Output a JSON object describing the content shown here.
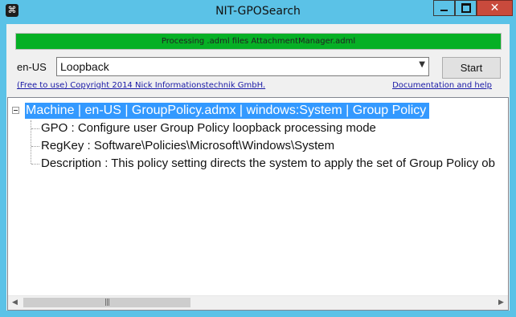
{
  "window": {
    "title": "NIT-GPOSearch",
    "icon": "gpo-search-app-icon",
    "controls": {
      "minimize": "minimize-icon",
      "maximize": "maximize-icon",
      "close": "✕"
    }
  },
  "progress": {
    "text": "Processing .adml files AttachmentManager.adml",
    "value": 1.0,
    "color": "#06b025"
  },
  "search": {
    "language": "en-US",
    "query": "Loopback",
    "start_label": "Start"
  },
  "links": {
    "copyright": "(Free to use) Copyright 2014 Nick Informationstechnik GmbH.",
    "documentation": "Documentation and help"
  },
  "tree": {
    "root": "Machine | en-US | GroupPolicy.admx | windows:System | Group Policy",
    "children": [
      "GPO : Configure user Group Policy loopback processing mode",
      "RegKey : Software\\Policies\\Microsoft\\Windows\\System",
      "Description : This policy setting directs the system to apply the set of Group Policy ob"
    ],
    "selection_color": "#3399ff"
  },
  "colors": {
    "window_frame": "#5bc2e7",
    "close_button": "#c94a3c",
    "link": "#1a1aa6"
  }
}
